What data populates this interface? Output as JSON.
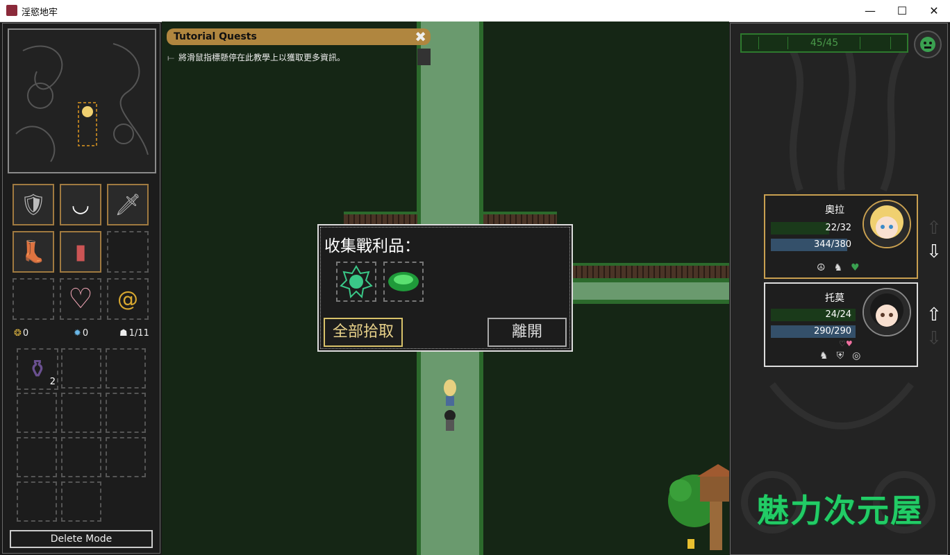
{
  "window": {
    "title": "淫慾地牢",
    "minimize": "—",
    "maximize": "☐",
    "close": "✕"
  },
  "tutorial": {
    "header": "Tutorial Quests",
    "close": "✖",
    "hint": "將滑鼠指標懸停在此教學上以獲取更多資訊。"
  },
  "hud": {
    "hp_text": "45/45",
    "counters": [
      {
        "icon": "gold-coin-icon",
        "value": "0"
      },
      {
        "icon": "gear-token-icon",
        "value": "0"
      },
      {
        "icon": "bag-icon",
        "value": "1/11"
      }
    ],
    "potion_count": "2",
    "delete_mode": "Delete Mode"
  },
  "equipment": [
    "armor-icon",
    "bikini-icon",
    "sword-icon",
    "boots-icon",
    "gauntlet-icon",
    "empty",
    "empty",
    "heart-icon",
    "spiral-icon"
  ],
  "loot_dialog": {
    "title": "收集戰利品：",
    "items": [
      "green-seal-icon",
      "emerald-gem-icon"
    ],
    "take_all": "全部拾取",
    "leave": "離開"
  },
  "party": [
    {
      "name": "奧拉",
      "hp": "22/32",
      "hp_fraction": 0.6875,
      "mp": "344/380",
      "mp_fraction": 0.905,
      "selected": true,
      "icons": [
        "☮",
        "♞",
        "♥"
      ]
    },
    {
      "name": "托莫",
      "hp": "24/24",
      "hp_fraction": 1.0,
      "mp": "290/290",
      "mp_fraction": 1.0,
      "selected": false,
      "icons": [
        "♞",
        "⛨",
        "◎"
      ]
    }
  ],
  "watermark": "魅力次元屋",
  "colors": {
    "accent": "#b0863f",
    "hp_green": "#2e7a2e",
    "mp_blue": "#34506a",
    "watermark": "#22cc66"
  }
}
